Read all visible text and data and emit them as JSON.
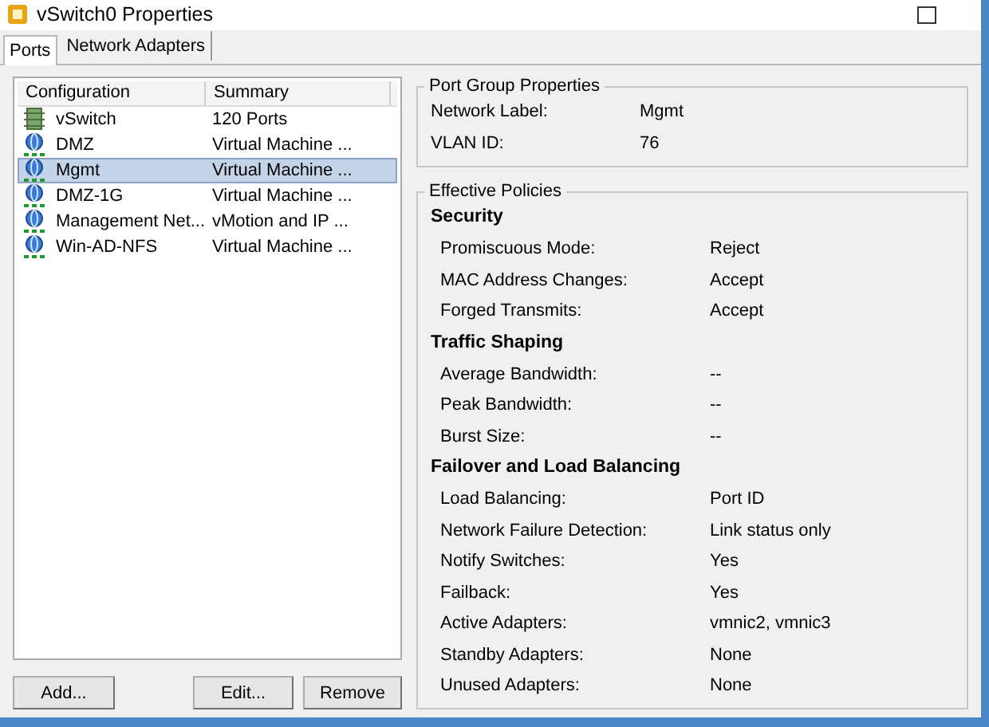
{
  "window": {
    "title": "vSwitch0 Properties"
  },
  "tabs": [
    {
      "label": "Ports",
      "selected": true
    },
    {
      "label": "Network Adapters",
      "selected": false
    }
  ],
  "port_list": {
    "columns": [
      "Configuration",
      "Summary"
    ],
    "rows": [
      {
        "kind": "switch",
        "configuration": "vSwitch",
        "summary": "120 Ports",
        "selected": false
      },
      {
        "kind": "port_group",
        "configuration": "DMZ",
        "summary": "Virtual Machine ...",
        "selected": false
      },
      {
        "kind": "port_group",
        "configuration": "Mgmt",
        "summary": "Virtual Machine ...",
        "selected": true
      },
      {
        "kind": "port_group",
        "configuration": "DMZ-1G",
        "summary": "Virtual Machine ...",
        "selected": false
      },
      {
        "kind": "port_group",
        "configuration": "Management Net...",
        "summary": "vMotion and IP ...",
        "selected": false
      },
      {
        "kind": "port_group",
        "configuration": "Win-AD-NFS",
        "summary": "Virtual Machine ...",
        "selected": false
      }
    ]
  },
  "buttons": [
    "Add...",
    "Edit...",
    "Remove"
  ],
  "port_group_properties": {
    "title": "Port Group Properties",
    "fields": [
      {
        "label": "Network Label:",
        "value": "Mgmt"
      },
      {
        "label": "VLAN ID:",
        "value": "76"
      }
    ]
  },
  "effective_policies": {
    "title": "Effective Policies",
    "sections": [
      {
        "heading": "Security",
        "fields": [
          {
            "label": "Promiscuous Mode:",
            "value": "Reject"
          },
          {
            "label": "MAC Address Changes:",
            "value": "Accept"
          },
          {
            "label": "Forged Transmits:",
            "value": "Accept"
          }
        ]
      },
      {
        "heading": "Traffic Shaping",
        "fields": [
          {
            "label": "Average Bandwidth:",
            "value": "--"
          },
          {
            "label": "Peak Bandwidth:",
            "value": "--"
          },
          {
            "label": "Burst Size:",
            "value": "--"
          }
        ]
      },
      {
        "heading": "Failover and Load Balancing",
        "fields": [
          {
            "label": "Load Balancing:",
            "value": "Port ID"
          },
          {
            "label": "Network Failure Detection:",
            "value": "Link status only"
          },
          {
            "label": "Notify Switches:",
            "value": "Yes"
          },
          {
            "label": "Failback:",
            "value": "Yes"
          },
          {
            "label": "Active Adapters:",
            "value": "vmnic2, vmnic3"
          },
          {
            "label": "Standby Adapters:",
            "value": "None"
          },
          {
            "label": "Unused Adapters:",
            "value": "None"
          }
        ]
      }
    ]
  }
}
